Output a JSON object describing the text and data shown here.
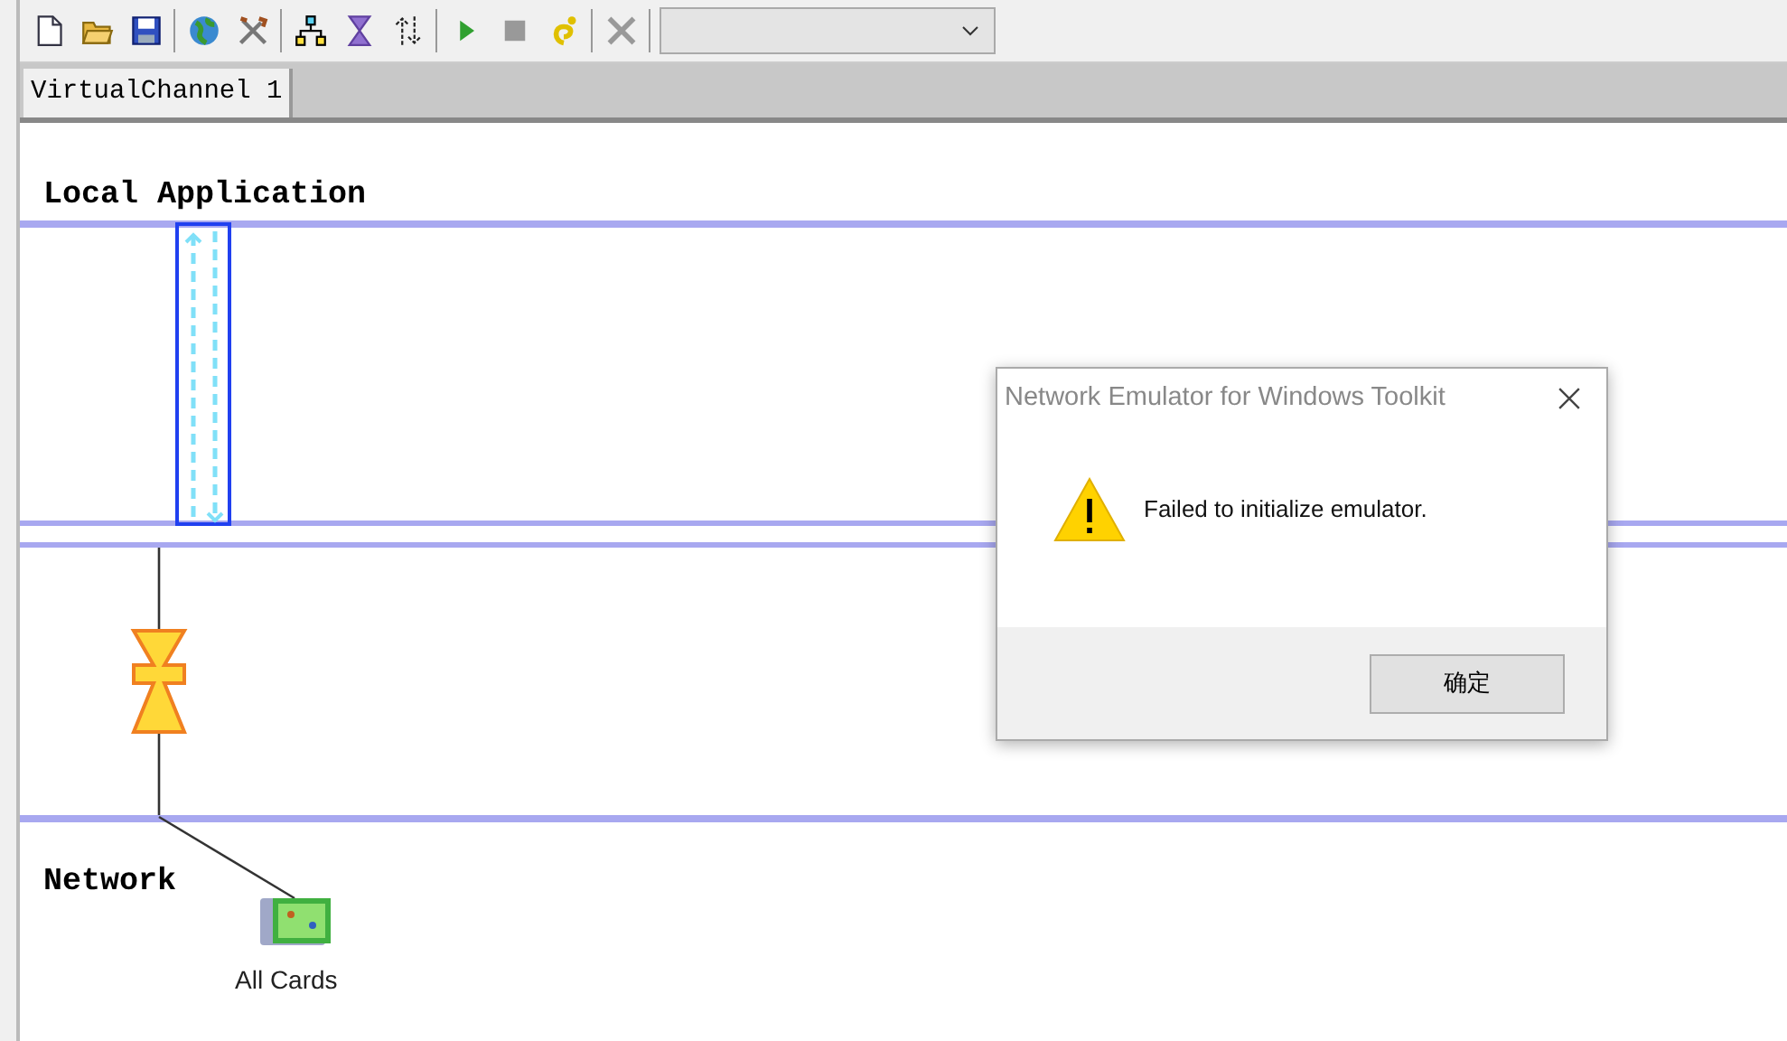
{
  "tabs": [
    {
      "label": "VirtualChannel 1",
      "selected": true
    }
  ],
  "diagram": {
    "local_label": "Local Application",
    "network_label": "Network",
    "card_label": "All Cards"
  },
  "dialog": {
    "title": "Network Emulator for Windows Toolkit",
    "message": "Failed to initialize emulator.",
    "buttons": [
      "确定"
    ]
  }
}
